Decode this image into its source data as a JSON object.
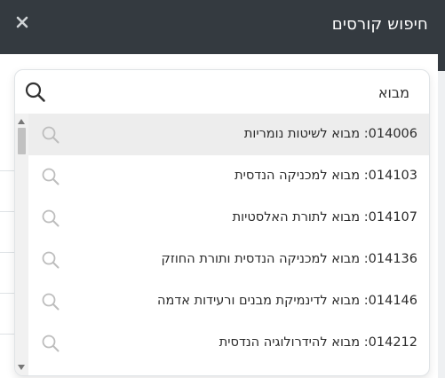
{
  "header": {
    "title": "חיפוש קורסים",
    "close_icon": "close-icon"
  },
  "search": {
    "value": "מבוא",
    "placeholder": ""
  },
  "results": [
    {
      "code": "014006",
      "name": "מבוא לשיטות נומריות",
      "highlighted": true
    },
    {
      "code": "014103",
      "name": "מבוא למכניקה הנדסית",
      "highlighted": false
    },
    {
      "code": "014107",
      "name": "מבוא לתורת האלסטיות",
      "highlighted": false
    },
    {
      "code": "014136",
      "name": "מבוא למכניקה הנדסית ותורת החוזק",
      "highlighted": false
    },
    {
      "code": "014146",
      "name": "מבוא לדינמיקת מבנים ורעידות אדמה",
      "highlighted": false
    },
    {
      "code": "014212",
      "name": "מבוא להידרולוגיה הנדסית",
      "highlighted": false
    }
  ],
  "colors": {
    "header_bg": "#343a40",
    "highlight_bg": "#ededed"
  }
}
